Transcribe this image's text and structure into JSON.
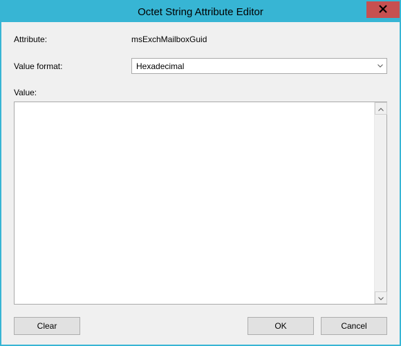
{
  "window": {
    "title": "Octet String Attribute Editor"
  },
  "labels": {
    "attribute": "Attribute:",
    "value_format": "Value format:",
    "value": "Value:"
  },
  "attribute_name": "msExchMailboxGuid",
  "value_format_selected": "Hexadecimal",
  "value_text": "",
  "buttons": {
    "clear": "Clear",
    "ok": "OK",
    "cancel": "Cancel"
  }
}
